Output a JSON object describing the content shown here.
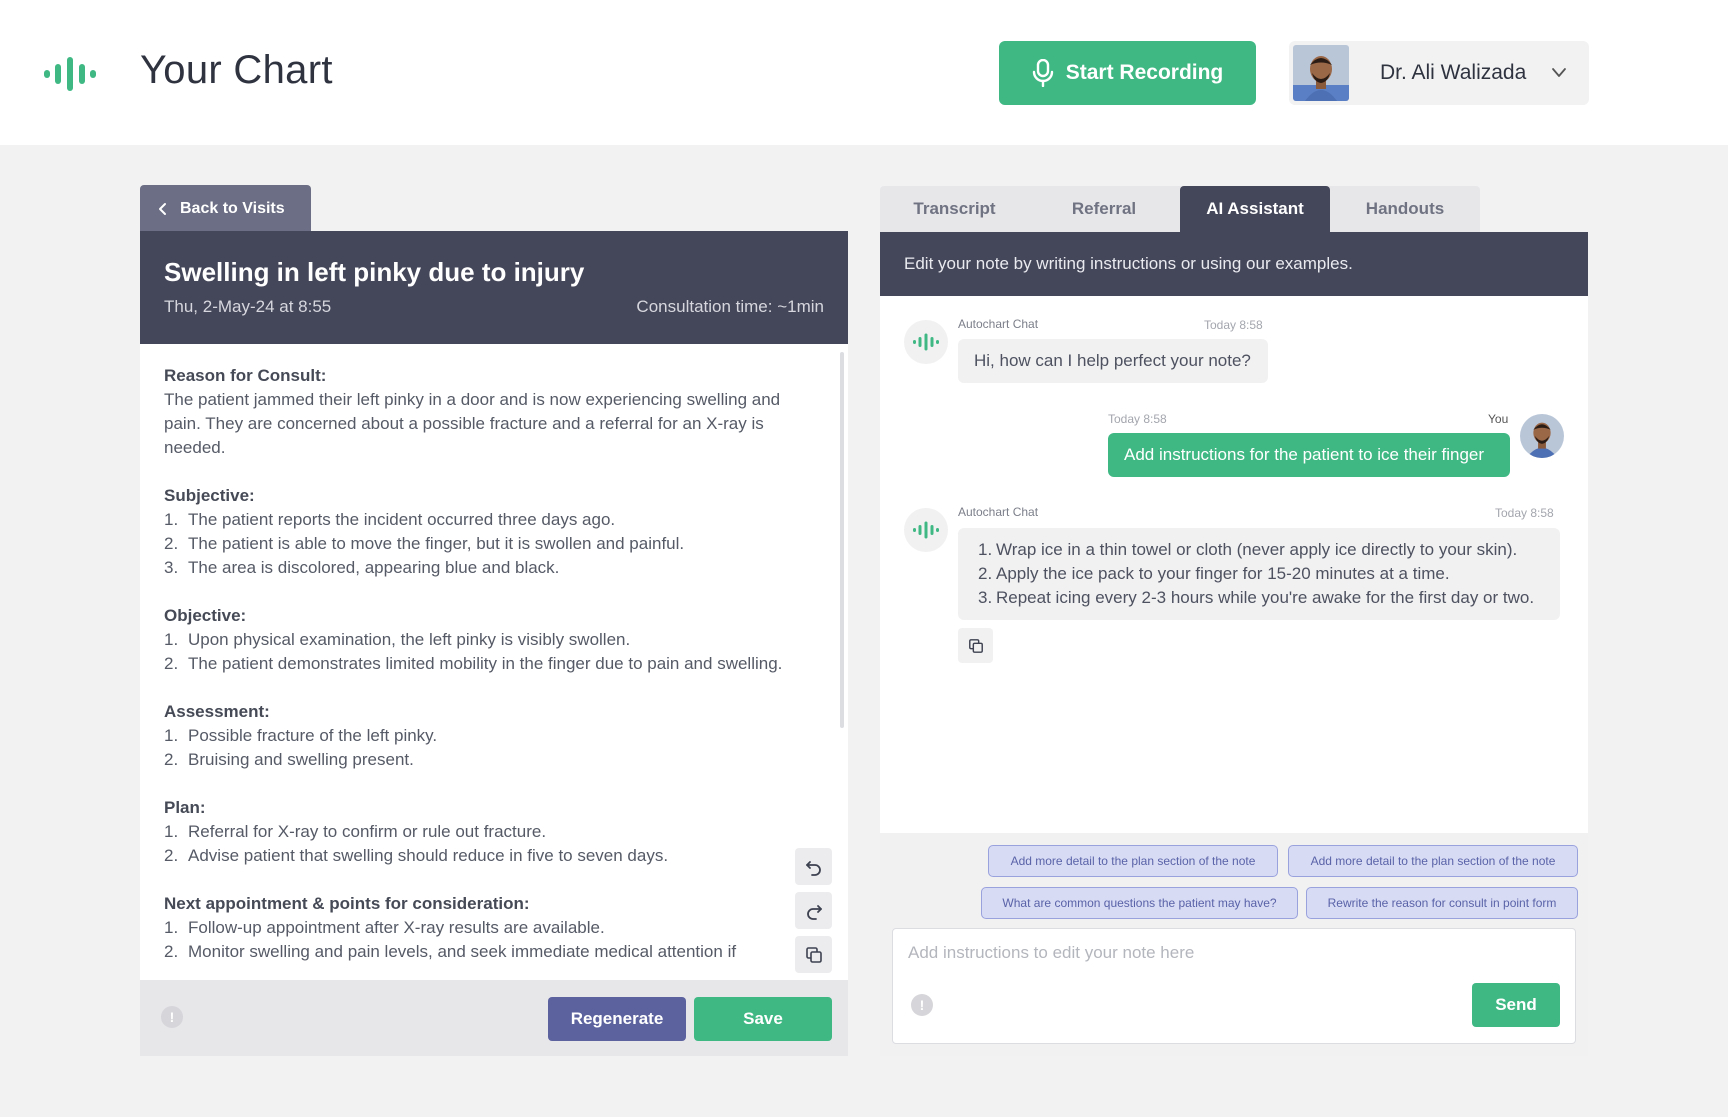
{
  "app": {
    "title": "Your Chart",
    "logo_icon": "audio-wave-icon",
    "brand_color": "#3fb884"
  },
  "header": {
    "record_button": "Start Recording",
    "user_name": "Dr. Ali Walizada"
  },
  "visit": {
    "back_label": "Back to Visits",
    "title": "Swelling in left pinky due to injury",
    "date": "Thu, 2-May-24 at 8:55",
    "consultation_time": "Consultation time: ~1min"
  },
  "note": {
    "sections": [
      {
        "heading": "Reason for Consult:",
        "text": "The patient jammed their left pinky in a door and is now experiencing swelling and pain. They are concerned about a possible fracture and a referral for an X-ray is needed."
      },
      {
        "heading": "Subjective:",
        "items": [
          "The patient reports the incident occurred three days ago.",
          "The patient is able to move the finger, but it is swollen and painful.",
          "The area is discolored, appearing blue and black."
        ]
      },
      {
        "heading": "Objective:",
        "items": [
          "Upon physical examination, the left pinky is visibly swollen.",
          "The patient demonstrates limited mobility in the finger due to pain and swelling."
        ]
      },
      {
        "heading": "Assessment:",
        "items": [
          "Possible fracture of the left pinky.",
          "Bruising and swelling present."
        ]
      },
      {
        "heading": "Plan:",
        "items": [
          "Referral for X-ray to confirm or rule out fracture.",
          "Advise patient that swelling should reduce in five to seven days."
        ]
      },
      {
        "heading": "Next appointment & points for consideration:",
        "items": [
          "Follow-up appointment after X-ray results are available.",
          "Monitor swelling and pain levels, and seek immediate medical attention if"
        ]
      }
    ],
    "regenerate_label": "Regenerate",
    "save_label": "Save"
  },
  "tabs": {
    "transcript": "Transcript",
    "referral": "Referral",
    "ai_assistant": "AI Assistant",
    "handouts": "Handouts",
    "active": "AI Assistant"
  },
  "assistant": {
    "instructions": "Edit your note by writing instructions or using our examples.",
    "messages": [
      {
        "sender": "Autochart Chat",
        "time": "Today 8:58",
        "text": "Hi, how can I help perfect your note?"
      },
      {
        "sender": "You",
        "time": "Today 8:58",
        "text": "Add instructions for the patient to ice their finger"
      },
      {
        "sender": "Autochart Chat",
        "time": "Today 8:58",
        "items": [
          "Wrap ice in a thin towel or cloth (never apply ice directly to your skin).",
          "Apply the ice pack to your finger for 15-20 minutes at a time.",
          "Repeat icing every 2-3 hours while you're awake for the first day or two."
        ]
      }
    ],
    "suggestions": [
      "Add more detail to the plan section of the note",
      "Add more detail to the plan section of the note",
      "What are common questions the patient may have?",
      "Rewrite the reason for consult in point form"
    ],
    "input_placeholder": "Add instructions to edit your note here",
    "send_label": "Send"
  }
}
